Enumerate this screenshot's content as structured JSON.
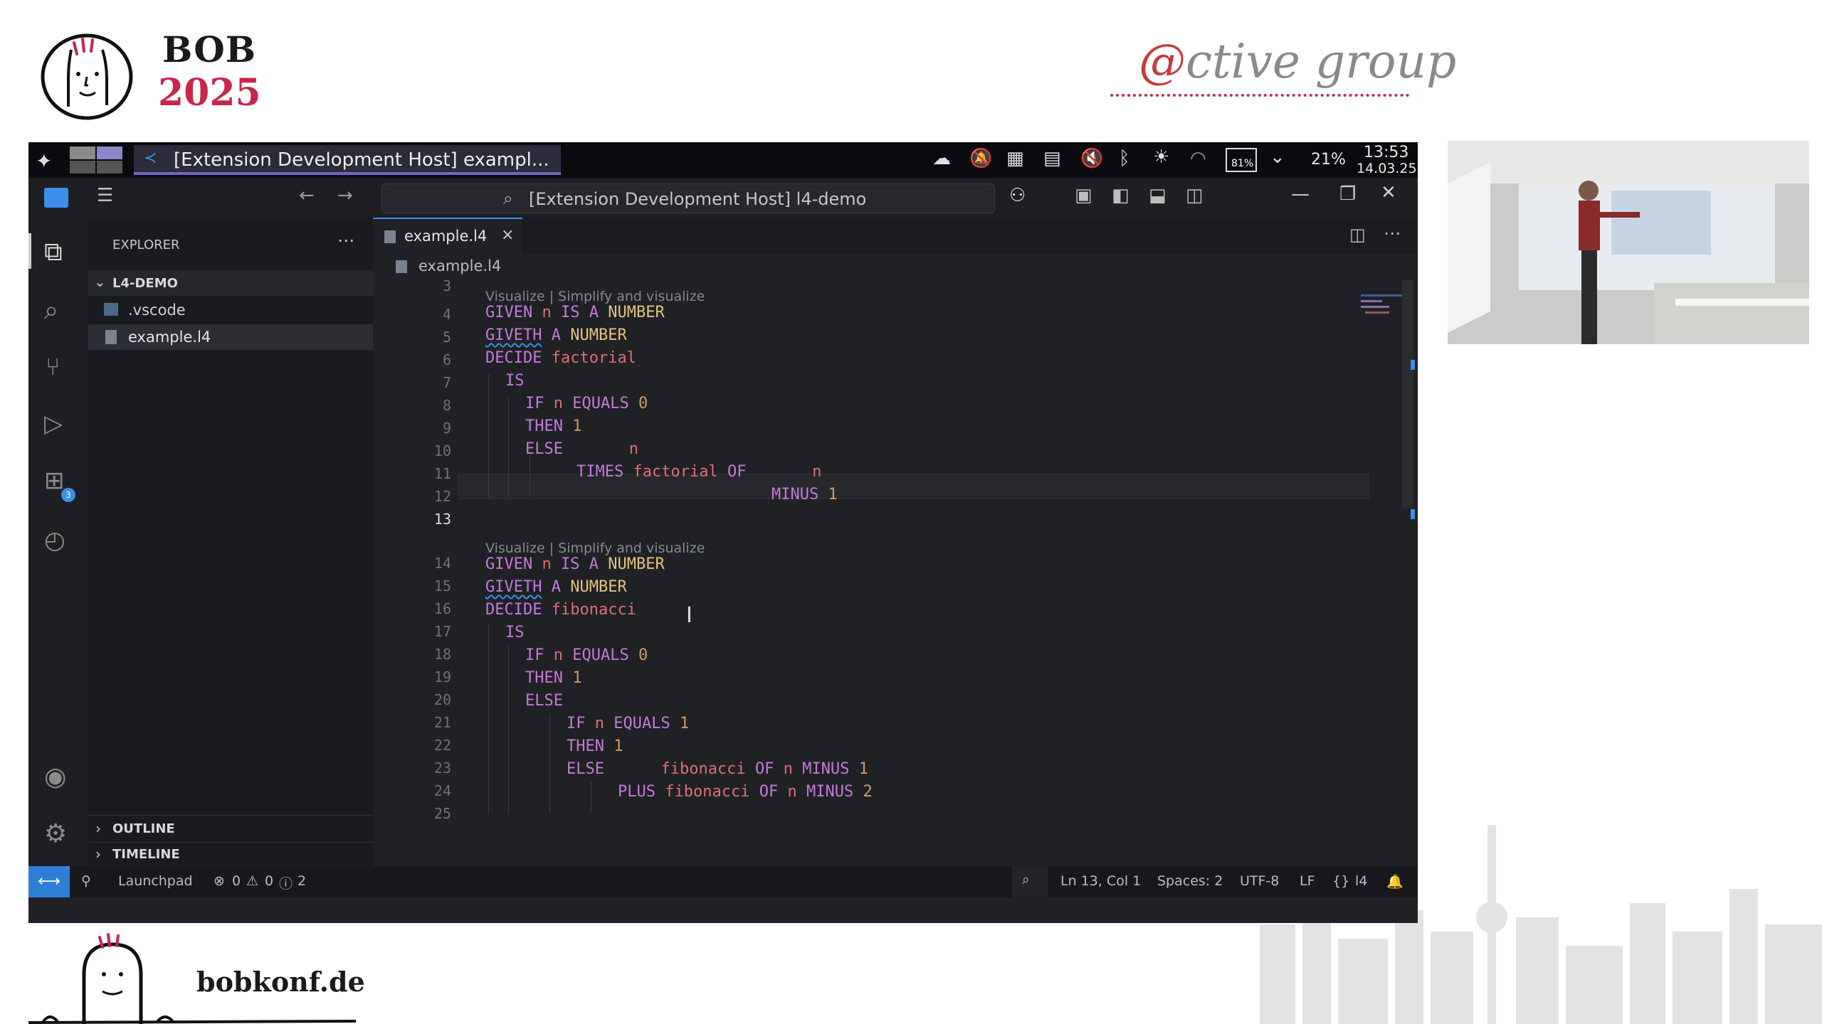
{
  "conference": {
    "name": "BOB",
    "year": "2025",
    "sponsor": "@ctive group",
    "website": "bobkonf.de"
  },
  "taskbar": {
    "window_title": "[Extension Development Host] exampl...",
    "battery": "21%",
    "time": "13:53",
    "date": "14.03.25",
    "icons": [
      "weather-icon",
      "notifications-off-icon",
      "grid-icon",
      "clipboard-icon",
      "volume-muted-icon",
      "bluetooth-icon",
      "brightness-icon",
      "wifi-icon",
      "display-81-icon",
      "chevron-down-icon"
    ],
    "display_pct": "81%"
  },
  "vscode": {
    "command_center": "[Extension Development Host] l4-demo",
    "explorer_title": "EXPLORER",
    "folder": "L4-DEMO",
    "files": [
      ".vscode",
      "example.l4"
    ],
    "outline": "OUTLINE",
    "timeline": "TIMELINE",
    "tab": "example.l4",
    "breadcrumb": "example.l4",
    "extensions_badge": "3",
    "code_lens": "Visualize | Simplify and visualize",
    "line_numbers": [
      "3",
      "4",
      "5",
      "6",
      "7",
      "8",
      "9",
      "10",
      "11",
      "12",
      "13",
      "14",
      "15",
      "16",
      "17",
      "18",
      "19",
      "20",
      "21",
      "22",
      "23",
      "24",
      "25"
    ]
  },
  "code": {
    "l4": [
      "GIVEN",
      "n",
      "IS A",
      "NUMBER"
    ],
    "l5": [
      "GIVETH",
      "A",
      "NUMBER"
    ],
    "l6": [
      "DECIDE",
      "factorial"
    ],
    "l7": "IS",
    "l8": [
      "IF",
      "n",
      "EQUALS",
      "0"
    ],
    "l9": [
      "THEN",
      "1"
    ],
    "l10": [
      "ELSE",
      "n"
    ],
    "l11": [
      "TIMES",
      "factorial",
      "OF",
      "n"
    ],
    "l12": [
      "MINUS",
      "1"
    ],
    "l14": [
      "GIVEN",
      "n",
      "IS A",
      "NUMBER"
    ],
    "l15": [
      "GIVETH",
      "A",
      "NUMBER"
    ],
    "l16": [
      "DECIDE",
      "fibonacci"
    ],
    "l17": "IS",
    "l18": [
      "IF",
      "n",
      "EQUALS",
      "0"
    ],
    "l19": [
      "THEN",
      "1"
    ],
    "l20": "ELSE",
    "l21": [
      "IF",
      "n",
      "EQUALS",
      "1"
    ],
    "l22": [
      "THEN",
      "1"
    ],
    "l23": [
      "ELSE",
      "fibonacci",
      "OF",
      "n",
      "MINUS",
      "1"
    ],
    "l24": [
      "PLUS",
      "fibonacci",
      "OF",
      "n",
      "MINUS",
      "2"
    ]
  },
  "statusbar": {
    "remote": "Launchpad",
    "errors": "0",
    "warnings": "0",
    "infos": "2",
    "position": "Ln 13, Col 1",
    "spaces": "Spaces: 2",
    "encoding": "UTF-8",
    "eol": "LF",
    "language": "l4"
  }
}
